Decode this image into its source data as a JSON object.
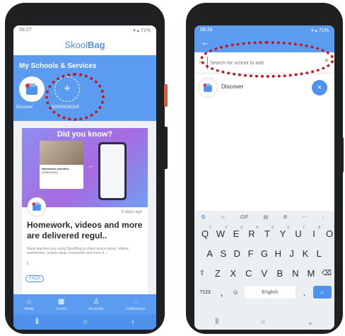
{
  "left": {
    "status_time": "06:27",
    "status_right": "▾ ▴ 71%",
    "brand_a": "Skool",
    "brand_b": "Bag",
    "section_title": "My Schools & Services",
    "tile_discover": "Discover",
    "tile_add_remove": "ADD/REMOVE",
    "card_heading": "Did you know?",
    "card_thumb_title": "Homework activities",
    "card_thumb_date": "(19/02/2020)",
    "card_time": "5 days ago",
    "card_title": "Homework, videos and more are delivered regul..",
    "card_body": "Many teachers are using SkoolBag to share lesson plans, videos, worksheets, activity ideas, homework and more d...",
    "faqs_tag": "FAQS",
    "tabs": [
      {
        "label": "Home",
        "icon": "home-icon"
      },
      {
        "label": "Events",
        "icon": "calendar-icon"
      },
      {
        "label": "My profile",
        "icon": "profile-icon"
      },
      {
        "label": "Notifications",
        "icon": "bell-icon"
      }
    ]
  },
  "right": {
    "status_time": "06:28",
    "status_right": "▾ ▴ 71%",
    "search_placeholder": "Search for school to add",
    "result_label": "Discover",
    "kb_toolbar": [
      "G",
      "GIF"
    ],
    "kb_row1": [
      "Q",
      "W",
      "E",
      "R",
      "T",
      "Y",
      "U",
      "I",
      "O",
      "P"
    ],
    "kb_row1_nums": [
      "1",
      "2",
      "3",
      "4",
      "5",
      "6",
      "7",
      "8",
      "9",
      "0"
    ],
    "kb_row2": [
      "A",
      "S",
      "D",
      "F",
      "G",
      "H",
      "J",
      "K",
      "L"
    ],
    "kb_row3": [
      "Z",
      "X",
      "C",
      "V",
      "B",
      "N",
      "M"
    ],
    "kb_sym": "?123",
    "kb_comma": ",",
    "kb_space": "English",
    "kb_period": "."
  },
  "colors": {
    "accent": "#4f92ee",
    "annotation": "#c8151b",
    "phone": "#1e2021"
  }
}
